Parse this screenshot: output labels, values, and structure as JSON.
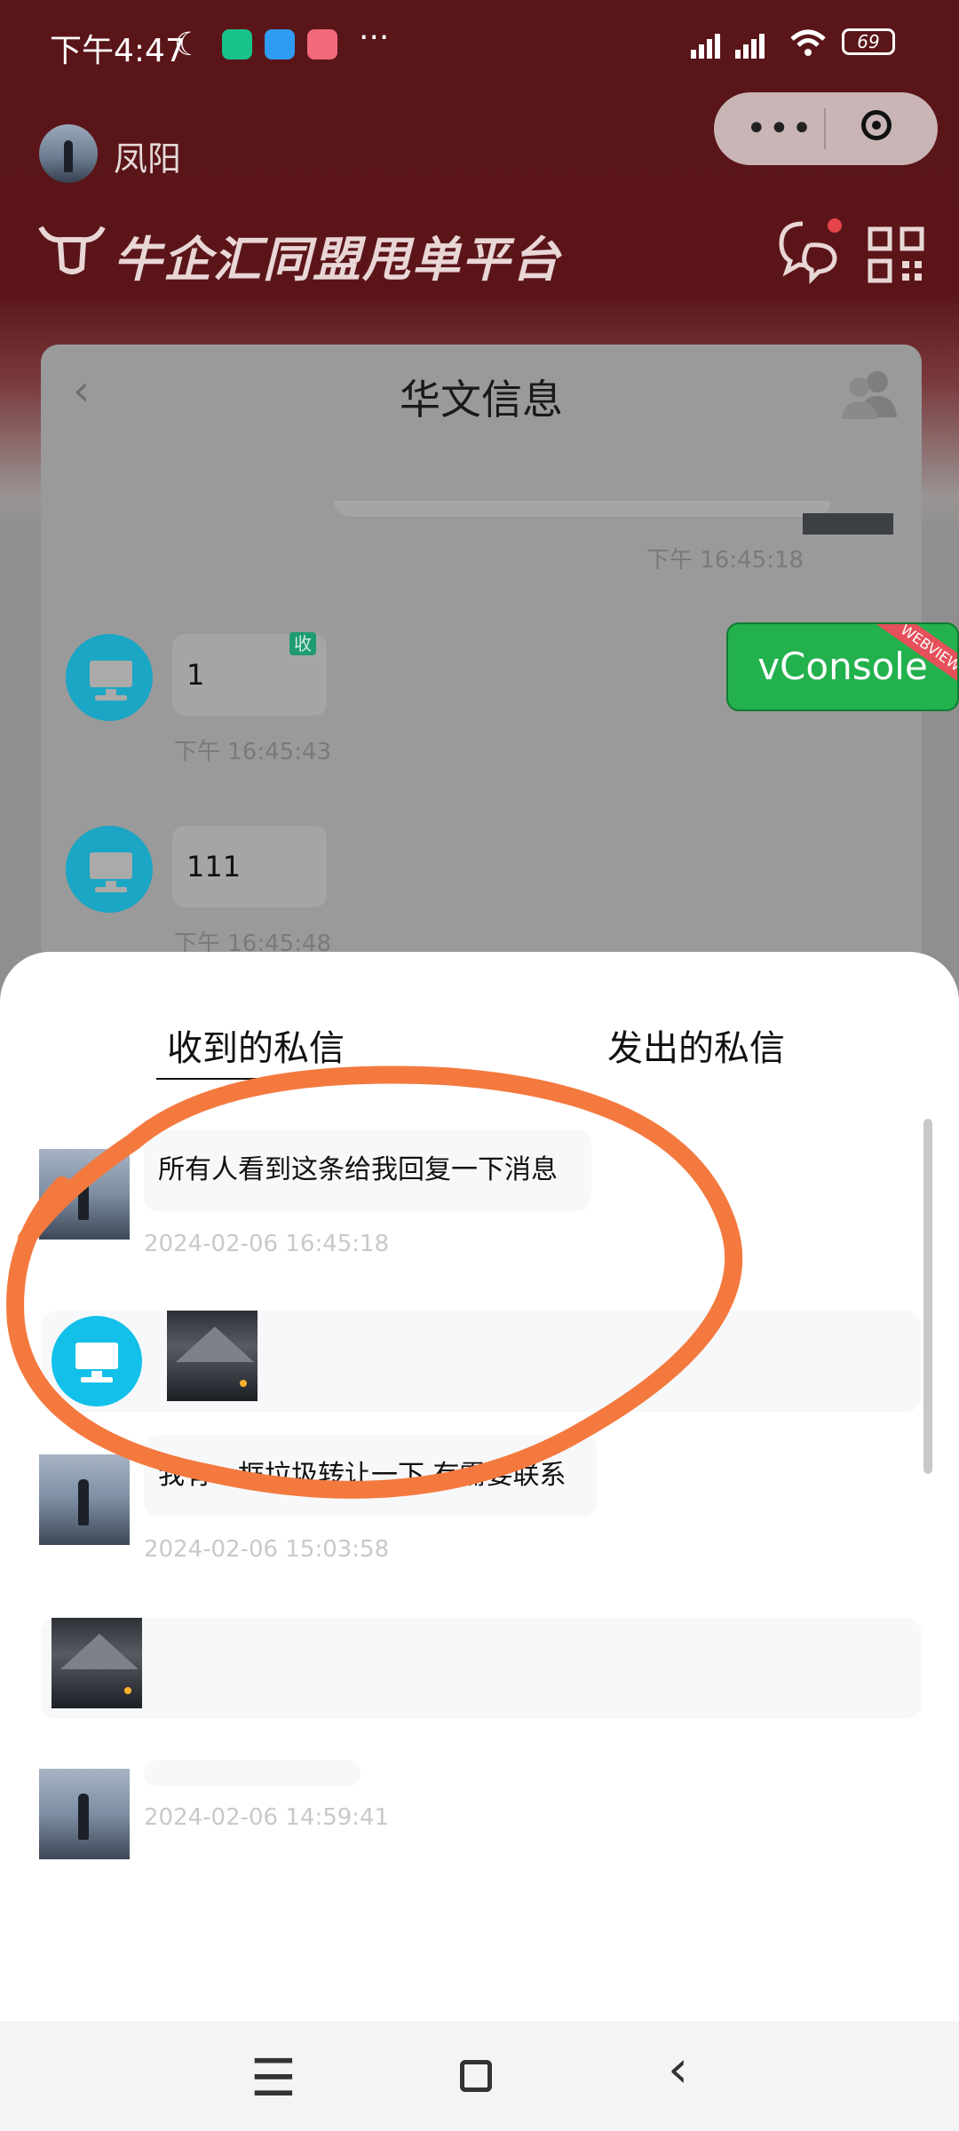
{
  "status_bar": {
    "time": "下午4:47",
    "more": "···",
    "battery": "69"
  },
  "header": {
    "user_name": "凤阳",
    "brand_title": "牛企汇同盟甩单平台"
  },
  "chat": {
    "title": "华文信息",
    "messages": [
      {
        "time": "下午 16:45:18"
      },
      {
        "text": "1",
        "badge": "收",
        "time": "下午 16:45:43"
      },
      {
        "text": "111",
        "time": "下午 16:45:48"
      }
    ]
  },
  "vconsole": {
    "label": "vConsole",
    "tag": "WEBVIEW"
  },
  "sheet": {
    "tabs": [
      {
        "label": "收到的私信",
        "active": true
      },
      {
        "label": "发出的私信",
        "active": false
      }
    ],
    "items": [
      {
        "avatar": "person-photo",
        "text": "所有人看到这条给我回复一下消息",
        "time": "2024-02-06 16:45:18"
      },
      {
        "avatar": "monitor-icon",
        "text": "",
        "time": ""
      },
      {
        "avatar": "person-photo",
        "text": "我有一框垃圾转让一下 有需要联系",
        "time": "2024-02-06 15:03:58"
      },
      {
        "avatar": "mountain-photo",
        "text": "",
        "time": ""
      },
      {
        "avatar": "person-photo",
        "text": "",
        "time": "2024-02-06 14:59:41"
      }
    ]
  },
  "colors": {
    "header_red": "#5a1519",
    "accent_cyan": "#12c0ea",
    "vconsole_green": "#23b14d",
    "annotation_orange": "#f4793f"
  }
}
